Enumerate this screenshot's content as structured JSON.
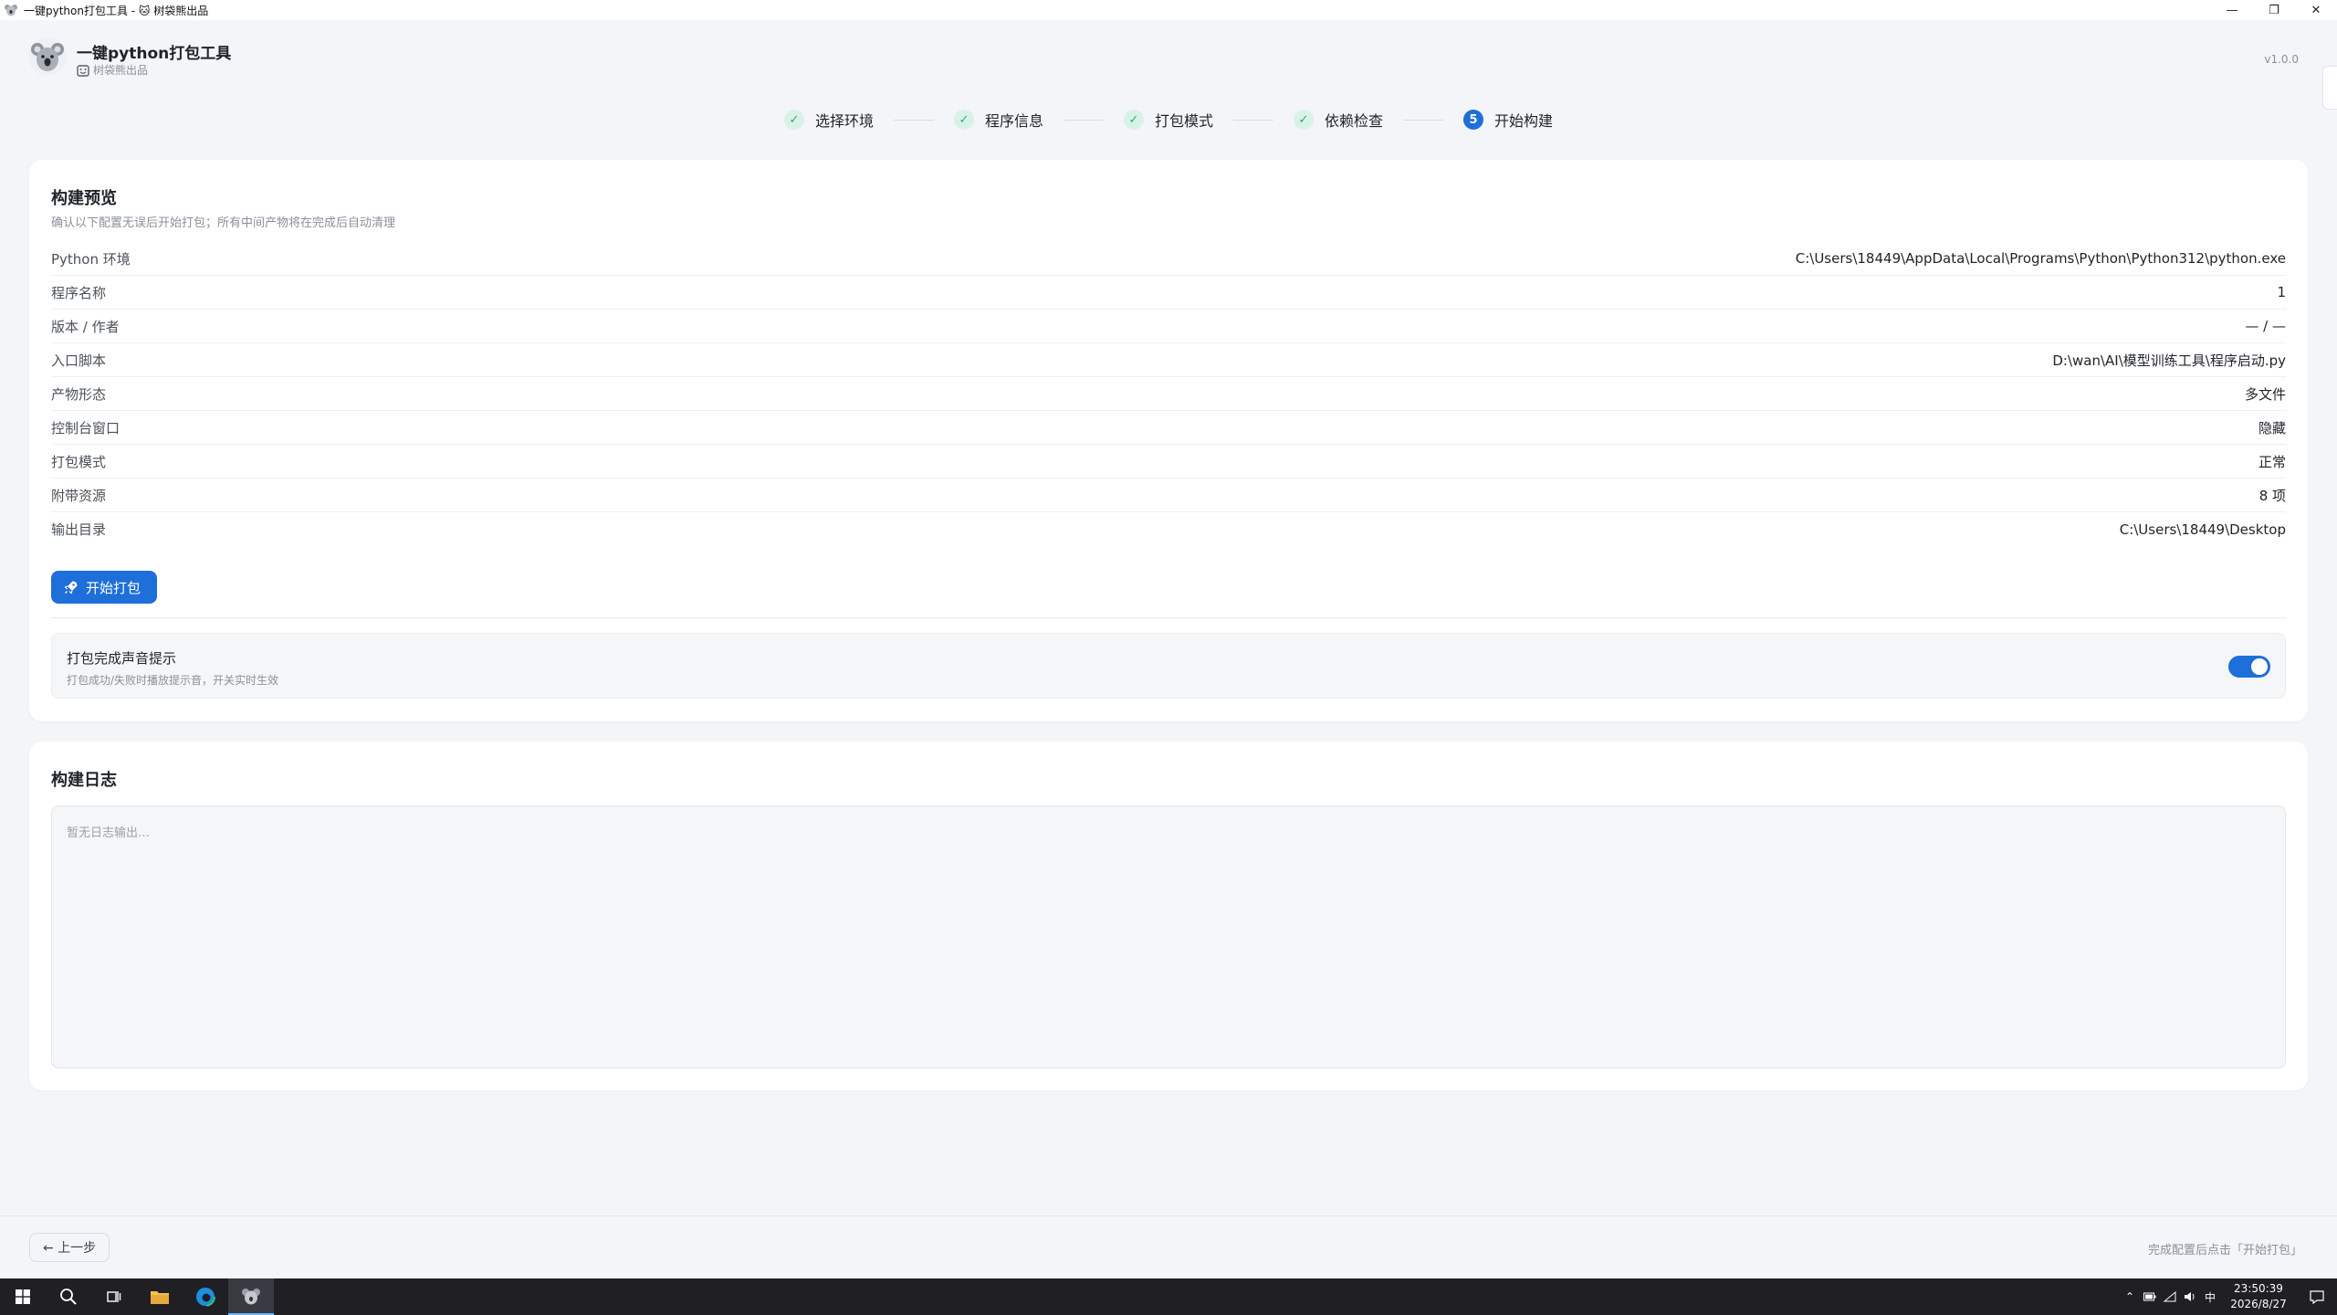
{
  "window": {
    "title": "一键python打包工具 - 🐱 树袋熊出品",
    "controls": [
      "—",
      "❐",
      "✕"
    ]
  },
  "header": {
    "app_title": "一键python打包工具",
    "app_subtitle": "树袋熊出品",
    "version": "v1.0.0"
  },
  "stepper": {
    "steps": [
      {
        "label": "选择环境",
        "state": "done",
        "marker": "✓"
      },
      {
        "label": "程序信息",
        "state": "done",
        "marker": "✓"
      },
      {
        "label": "打包模式",
        "state": "done",
        "marker": "✓"
      },
      {
        "label": "依赖检查",
        "state": "done",
        "marker": "✓"
      },
      {
        "label": "开始构建",
        "state": "active",
        "marker": "5"
      }
    ]
  },
  "preview": {
    "title": "构建预览",
    "description": "确认以下配置无误后开始打包；所有中间产物将在完成后自动清理",
    "rows": [
      {
        "key": "Python 环境",
        "value": "C:\\Users\\18449\\AppData\\Local\\Programs\\Python\\Python312\\python.exe"
      },
      {
        "key": "程序名称",
        "value": "1"
      },
      {
        "key": "版本 / 作者",
        "value": "— / —"
      },
      {
        "key": "入口脚本",
        "value": "D:\\wan\\AI\\模型训练工具\\程序启动.py"
      },
      {
        "key": "产物形态",
        "value": "多文件"
      },
      {
        "key": "控制台窗口",
        "value": "隐藏"
      },
      {
        "key": "打包模式",
        "value": "正常"
      },
      {
        "key": "附带资源",
        "value": "8 项"
      },
      {
        "key": "输出目录",
        "value": "C:\\Users\\18449\\Desktop"
      }
    ],
    "start_button": "开始打包",
    "sound": {
      "title": "打包完成声音提示",
      "description": "打包成功/失败时播放提示音，开关实时生效",
      "enabled": true
    }
  },
  "log": {
    "title": "构建日志",
    "placeholder": "暂无日志输出…"
  },
  "footer": {
    "back_button": "← 上一步",
    "hint": "完成配置后点击「开始打包」"
  },
  "taskbar": {
    "time": "23:50:39",
    "date": "2026/8/27",
    "ime": "中"
  },
  "colors": {
    "accent": "#1e6fd9",
    "done_bg": "#d9f2e8",
    "done_fg": "#2aa876"
  }
}
